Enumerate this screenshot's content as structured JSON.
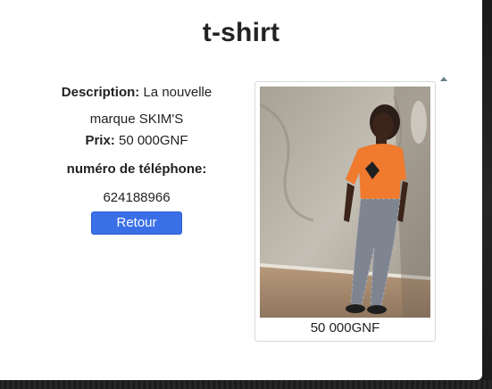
{
  "product": {
    "title": "t-shirt",
    "description_label": "Description:",
    "description_value_line1": "La nouvelle",
    "description_value_line2": "marque SKIM'S",
    "price_label": "Prix:",
    "price_value": "50 000GNF",
    "phone_label": "numéro de téléphone:",
    "phone_value": "624188966",
    "back_button": "Retour"
  },
  "card": {
    "photo_icon": "product-photo",
    "price": "50 000GNF"
  },
  "colors": {
    "button": "#3a6fe8",
    "shirt": "#f07a2e",
    "background": "#ffffff"
  }
}
